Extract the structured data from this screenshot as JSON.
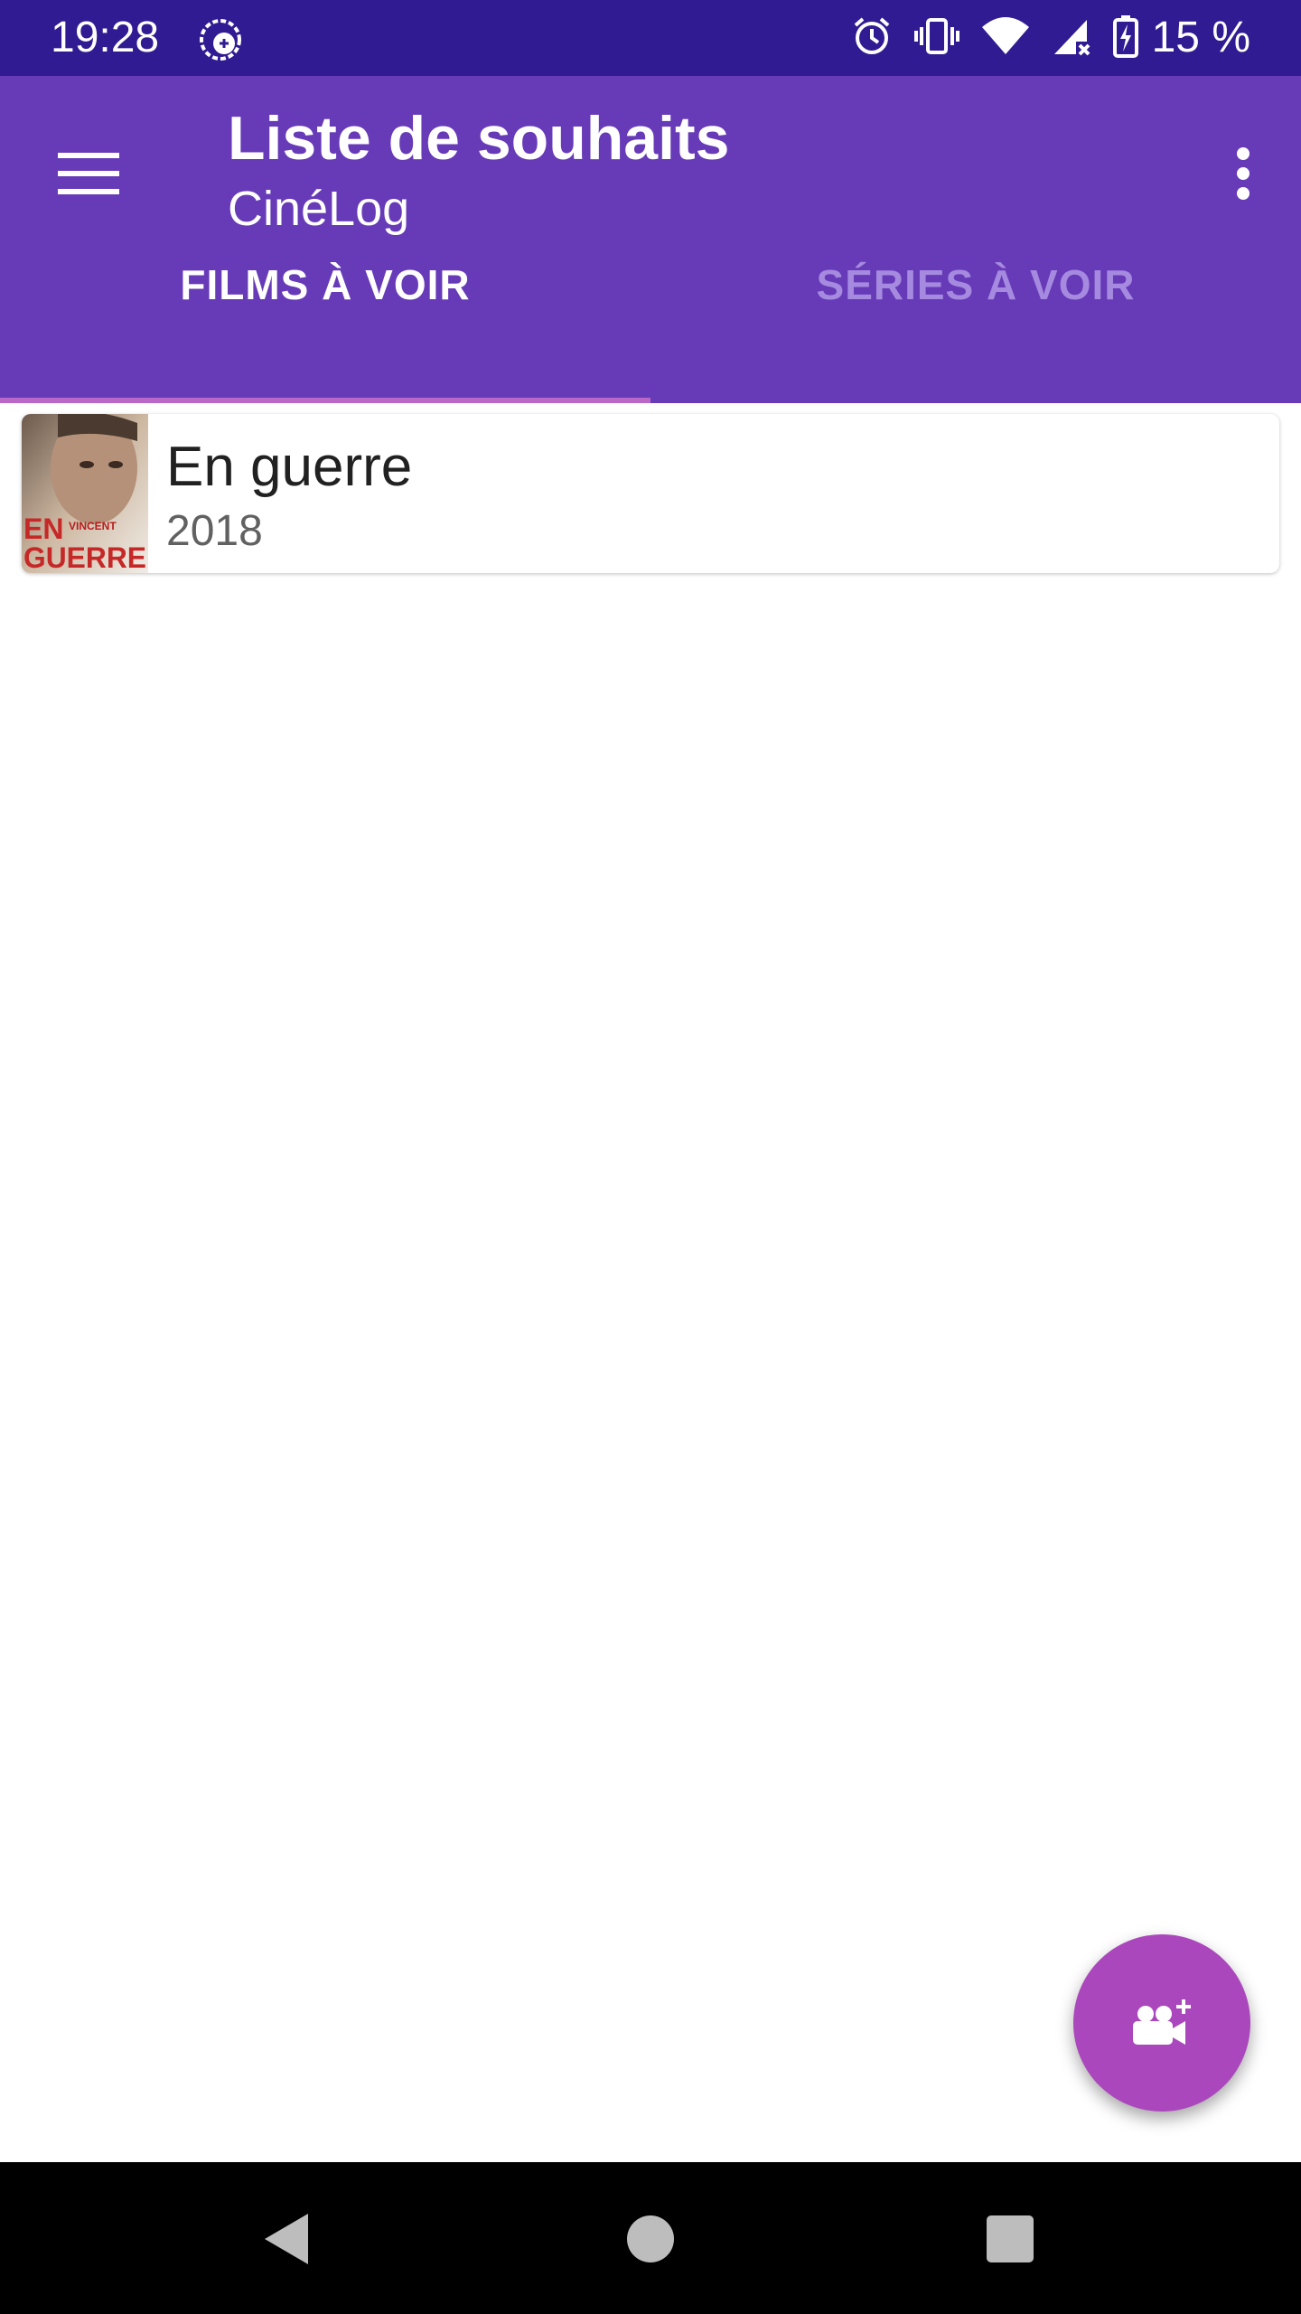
{
  "status_bar": {
    "time": "19:28",
    "battery": "15 %",
    "icons": [
      "app-notification-icon",
      "alarm-icon",
      "vibrate-icon",
      "wifi-icon",
      "cell-signal-icon",
      "battery-charging-icon"
    ]
  },
  "app_bar": {
    "title": "Liste de souhaits",
    "subtitle": "CinéLog",
    "menu_icon": "hamburger-menu-icon",
    "overflow_icon": "more-vert-icon"
  },
  "tabs": [
    {
      "label": "FILMS À VOIR",
      "selected": true
    },
    {
      "label": "SÉRIES À VOIR",
      "selected": false
    }
  ],
  "movies": [
    {
      "title": "En guerre",
      "year": "2018",
      "poster_text": [
        "VINCENT",
        "EN",
        "GUERRE"
      ]
    }
  ],
  "fab": {
    "icon": "add-movie-camera-icon"
  },
  "nav_bar": {
    "icons": [
      "back-icon",
      "home-icon",
      "recents-icon"
    ]
  },
  "colors": {
    "status_bar": "#311b92",
    "app_bar": "#673ab7",
    "tab_indicator": "#ba68c8",
    "fab": "#ab47bc",
    "inactive_tab": "#a58ae0"
  }
}
